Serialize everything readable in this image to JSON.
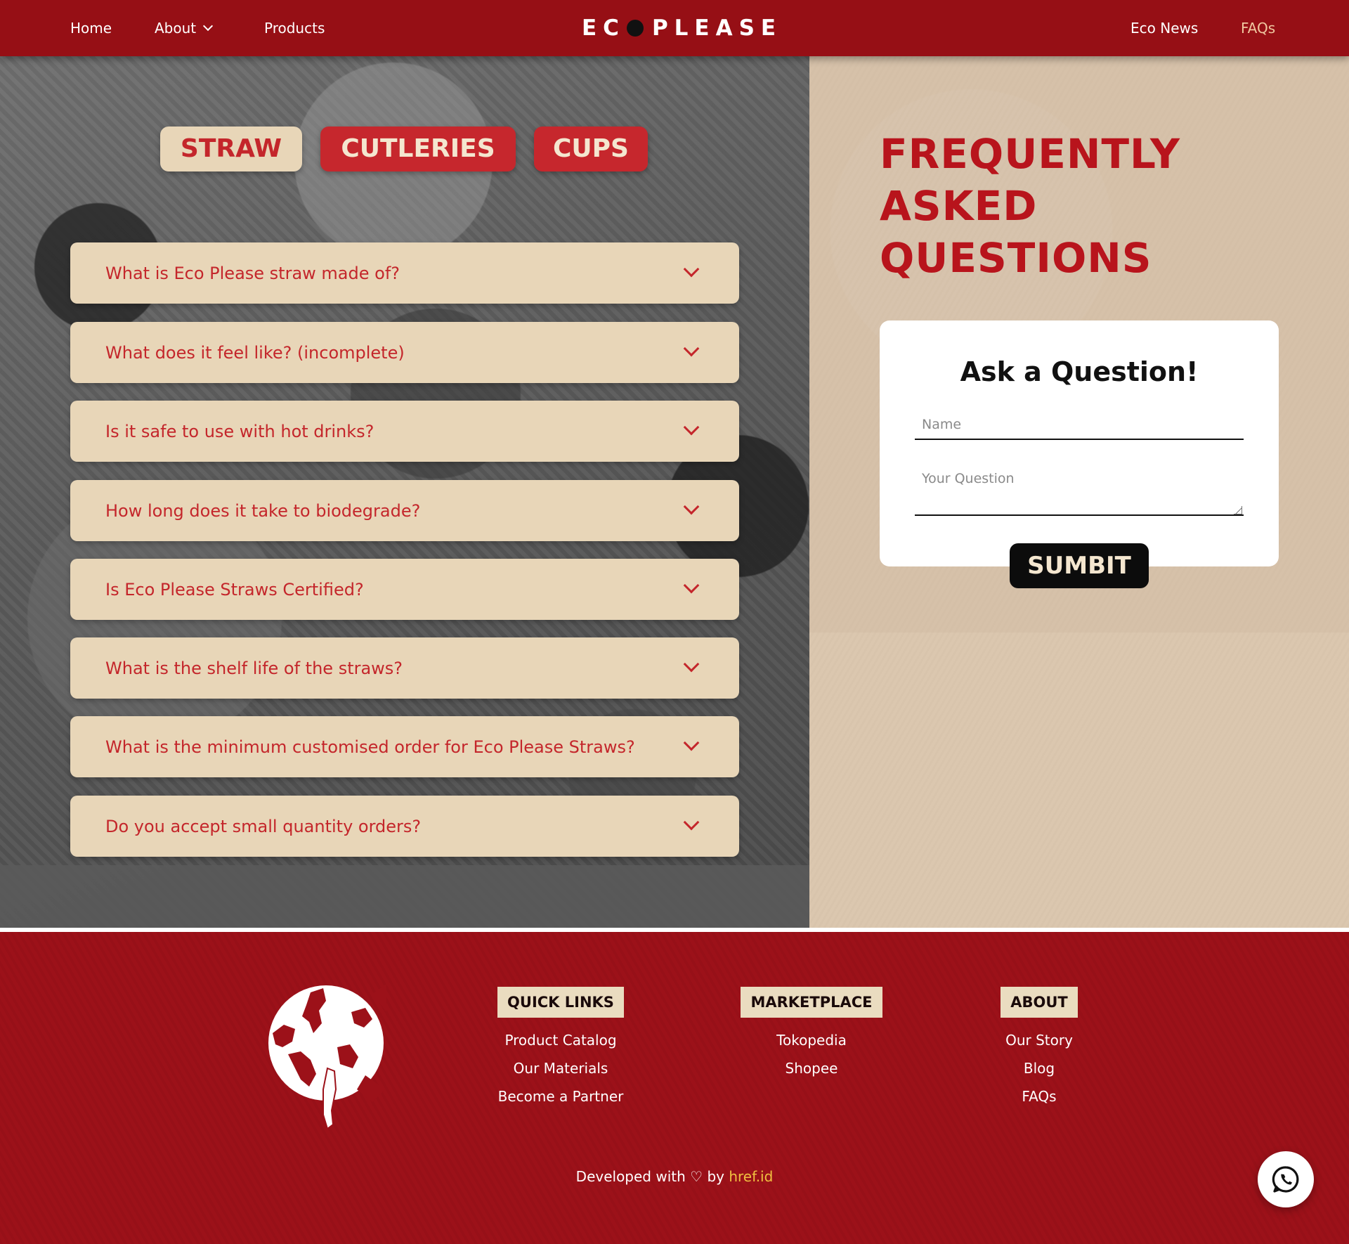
{
  "nav": {
    "home": "Home",
    "about": "About",
    "products": "Products",
    "logo_left": "EC",
    "logo_right": "PLEASE",
    "eco_news": "Eco News",
    "faqs": "FAQs",
    "active_color": "#f0c7a0"
  },
  "tabs": [
    {
      "label": "STRAW",
      "active": true
    },
    {
      "label": "CUTLERIES",
      "active": false
    },
    {
      "label": "CUPS",
      "active": false
    }
  ],
  "faq_items": [
    {
      "question": "What is Eco Please straw made of?"
    },
    {
      "question": "What does it feel like? (incomplete)"
    },
    {
      "question": "Is it safe to use with hot drinks?"
    },
    {
      "question": "How long does it take to biodegrade?"
    },
    {
      "question": "Is Eco Please Straws Certified?"
    },
    {
      "question": "What is the shelf life of the straws?"
    },
    {
      "question": "What is the minimum customised order for Eco Please Straws?"
    },
    {
      "question": "Do you accept small quantity orders?"
    }
  ],
  "faq_title": {
    "line1": "FREQUENTLY",
    "line2": "ASKED",
    "line3": "QUESTIONS"
  },
  "ask_form": {
    "title": "Ask a Question!",
    "name_placeholder": "Name",
    "question_placeholder": "Your Question",
    "submit_label": "SUMBIT"
  },
  "footer": {
    "quick_links": {
      "heading": "QUICK LINKS",
      "items": [
        "Product Catalog",
        "Our Materials",
        "Become a Partner"
      ]
    },
    "marketplace": {
      "heading": "MARKETPLACE",
      "items": [
        "Tokopedia",
        "Shopee"
      ]
    },
    "about": {
      "heading": "ABOUT",
      "items": [
        "Our Story",
        "Blog",
        "FAQs"
      ]
    },
    "credit_prefix": "Developed with ♡ by",
    "credit_link": "href.id"
  },
  "icons": {
    "whatsapp": "whatsapp-icon",
    "globe": "globe-logo-icon",
    "chevron": "chevron-down-icon"
  },
  "colors": {
    "brand_red": "#960f15",
    "faq_text": "#c4262b",
    "cream": "#e8d6b8",
    "link_accent": "#f0c040"
  }
}
